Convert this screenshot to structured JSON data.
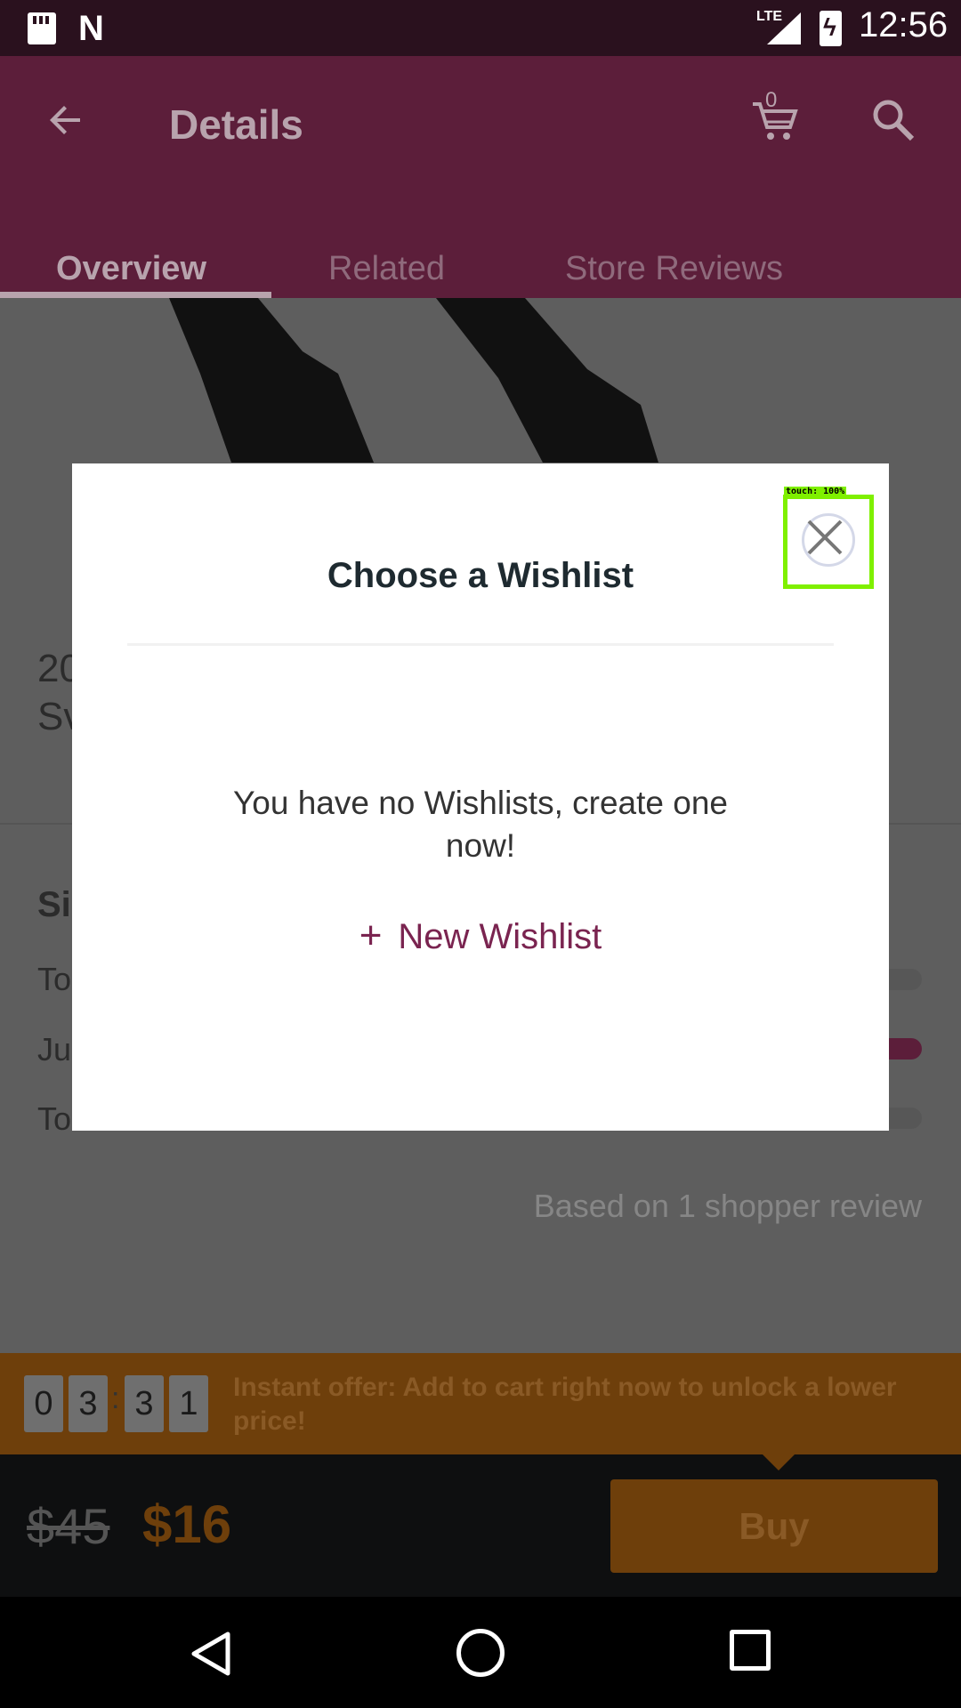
{
  "status_bar": {
    "time": "12:56",
    "network": "LTE"
  },
  "app_bar": {
    "title": "Details",
    "cart_count": "0",
    "tabs": [
      {
        "label": "Overview",
        "active": true
      },
      {
        "label": "Related",
        "active": false
      },
      {
        "label": "Store Reviews",
        "active": false
      }
    ]
  },
  "background_content": {
    "title_line1": "20",
    "title_line2": "Sv",
    "size_section_title": "Si",
    "size_rows": [
      {
        "label": "To"
      },
      {
        "label": "Ju"
      },
      {
        "label": "To"
      }
    ],
    "review_summary": "Based on 1 shopper review"
  },
  "offer": {
    "timer_digits": [
      "0",
      "3",
      "3",
      "1"
    ],
    "text": "Instant offer: Add to cart right now to unlock a lower price!"
  },
  "buy_bar": {
    "original_price": "$45",
    "sale_price": "$16",
    "buy_label": "Buy"
  },
  "dialog": {
    "title": "Choose a Wishlist",
    "empty_message": "You have no Wishlists, create one now!",
    "new_wishlist_label": "New Wishlist",
    "touch_label": "touch: 100%"
  },
  "colors": {
    "app_bar": "#5c1e3a",
    "accent": "#7a2450",
    "offer": "#e07e14",
    "touch_highlight": "#7ff000"
  }
}
